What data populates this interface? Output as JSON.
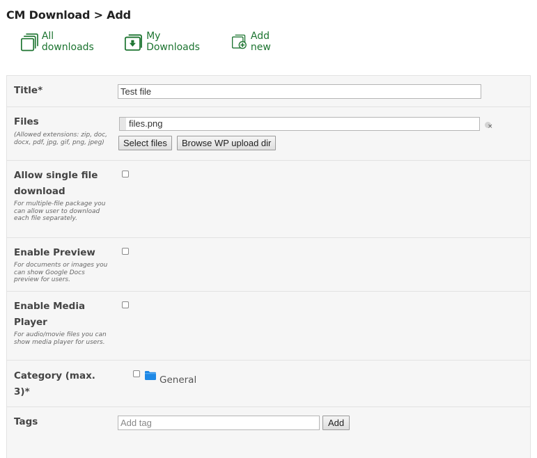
{
  "header": {
    "title": "CM Download > Add"
  },
  "nav": {
    "all_downloads": "All downloads",
    "my_downloads": "My Downloads",
    "add_new": "Add new"
  },
  "form": {
    "title": {
      "label": "Title*",
      "value": "Test file"
    },
    "files": {
      "label": "Files",
      "hint": "(Allowed extensions: zip, doc, docx, pdf, jpg, gif, png, jpeg)",
      "file_name": "files.png",
      "remove_glyph": "×",
      "select_button": "Select files",
      "browse_button": "Browse WP upload dir"
    },
    "single_download": {
      "label": "Allow single file download",
      "hint": "For multiple-file package you can allow user to download each file separately.",
      "checked": false
    },
    "preview": {
      "label": "Enable Preview",
      "hint": "For documents or images you can show Google Docs preview for users.",
      "checked": false
    },
    "media_player": {
      "label": "Enable Media Player",
      "hint": "For audio/movie files you can show media player for users.",
      "checked": false
    },
    "category": {
      "label": "Category (max. 3)*",
      "options": [
        {
          "name": "General",
          "checked": false
        }
      ]
    },
    "tags": {
      "label": "Tags",
      "placeholder": "Add tag",
      "value": "",
      "add_button": "Add"
    }
  },
  "colors": {
    "accent": "#1c7430",
    "folder": "#1e88e5",
    "panel_bg": "#f6f6f6",
    "divider": "#e2e2e2"
  },
  "icons": {
    "all_downloads": "folder-icon",
    "my_downloads": "folder-download-icon",
    "add_new": "folder-add-icon",
    "category": "folder-icon",
    "remove_file": "remove-icon"
  }
}
